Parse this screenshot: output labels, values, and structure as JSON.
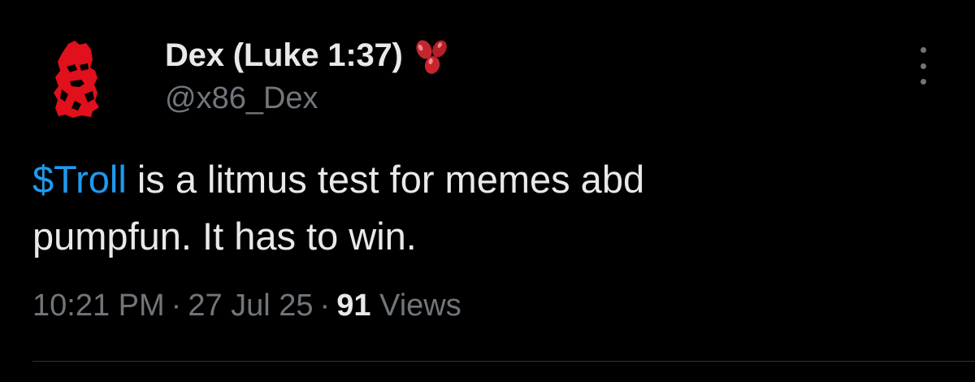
{
  "colors": {
    "background": "#000000",
    "primary_text": "#e7e9ea",
    "secondary_text": "#71767b",
    "accent": "#1d9bf0",
    "divider": "#2f3336",
    "avatar_red": "#e0101c"
  },
  "author": {
    "display_name": "Dex (Luke 1:37)",
    "name_emoji_icon": "kidney-beans-icon",
    "handle": "@x86_Dex",
    "avatar_icon": "red-face-avatar"
  },
  "actions": {
    "more_icon": "more-vertical-icon"
  },
  "tweet": {
    "cashtag": "$Troll",
    "text_line1": " is a litmus test for memes abd",
    "text_line2": "pumpfun. It has to win."
  },
  "meta": {
    "time": "10:21 PM",
    "separator": "·",
    "date": "27 Jul 25",
    "views_count": "91",
    "views_label": " Views"
  }
}
